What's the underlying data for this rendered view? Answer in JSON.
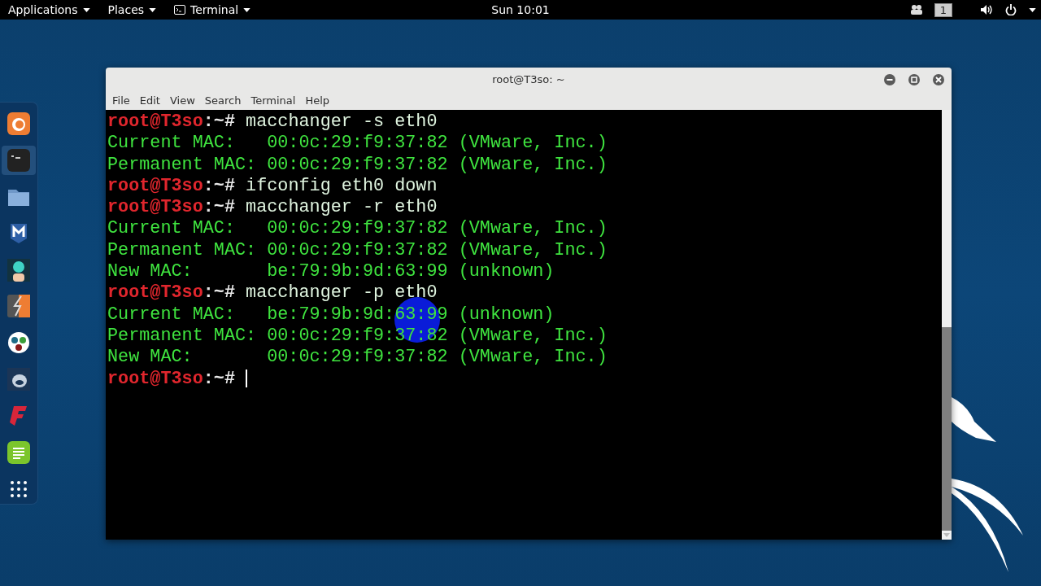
{
  "top_bar": {
    "menus": [
      {
        "label": "Applications"
      },
      {
        "label": "Places"
      },
      {
        "label": "Terminal",
        "app_icon": true
      }
    ],
    "clock": "Sun 10:01",
    "workspace": "1"
  },
  "dock": {
    "items": [
      {
        "selected": false
      },
      {
        "selected": true
      },
      {
        "selected": false
      },
      {
        "selected": false
      },
      {
        "selected": false
      },
      {
        "selected": false
      },
      {
        "selected": false
      },
      {
        "selected": false
      },
      {
        "selected": false
      },
      {
        "selected": false
      },
      {
        "selected": false
      }
    ]
  },
  "window": {
    "title": "root@T3so: ~",
    "menu": [
      "File",
      "Edit",
      "View",
      "Search",
      "Terminal",
      "Help"
    ]
  },
  "terminal": {
    "cursor_visible": true,
    "lines": [
      {
        "kind": "prompt",
        "prompt": "root@T3so",
        "path": ":~#",
        "command": "macchanger -s eth0"
      },
      {
        "kind": "output",
        "text": "Current MAC:   00:0c:29:f9:37:82 (VMware, Inc.)"
      },
      {
        "kind": "output",
        "text": "Permanent MAC: 00:0c:29:f9:37:82 (VMware, Inc.)"
      },
      {
        "kind": "prompt",
        "prompt": "root@T3so",
        "path": ":~#",
        "command": "ifconfig eth0 down"
      },
      {
        "kind": "prompt",
        "prompt": "root@T3so",
        "path": ":~#",
        "command": "macchanger -r eth0"
      },
      {
        "kind": "output",
        "text": "Current MAC:   00:0c:29:f9:37:82 (VMware, Inc.)"
      },
      {
        "kind": "output",
        "text": "Permanent MAC: 00:0c:29:f9:37:82 (VMware, Inc.)"
      },
      {
        "kind": "output",
        "text": "New MAC:       be:79:9b:9d:63:99 (unknown)"
      },
      {
        "kind": "prompt",
        "prompt": "root@T3so",
        "path": ":~#",
        "command": "macchanger -p eth0"
      },
      {
        "kind": "output",
        "text": "Current MAC:   be:79:9b:9d:63:99 (unknown)"
      },
      {
        "kind": "output",
        "text": "Permanent MAC: 00:0c:29:f9:37:82 (VMware, Inc.)"
      },
      {
        "kind": "output",
        "text": "New MAC:       00:0c:29:f9:37:82 (VMware, Inc.)"
      },
      {
        "kind": "prompt",
        "prompt": "root@T3so",
        "path": ":~#"
      }
    ]
  }
}
